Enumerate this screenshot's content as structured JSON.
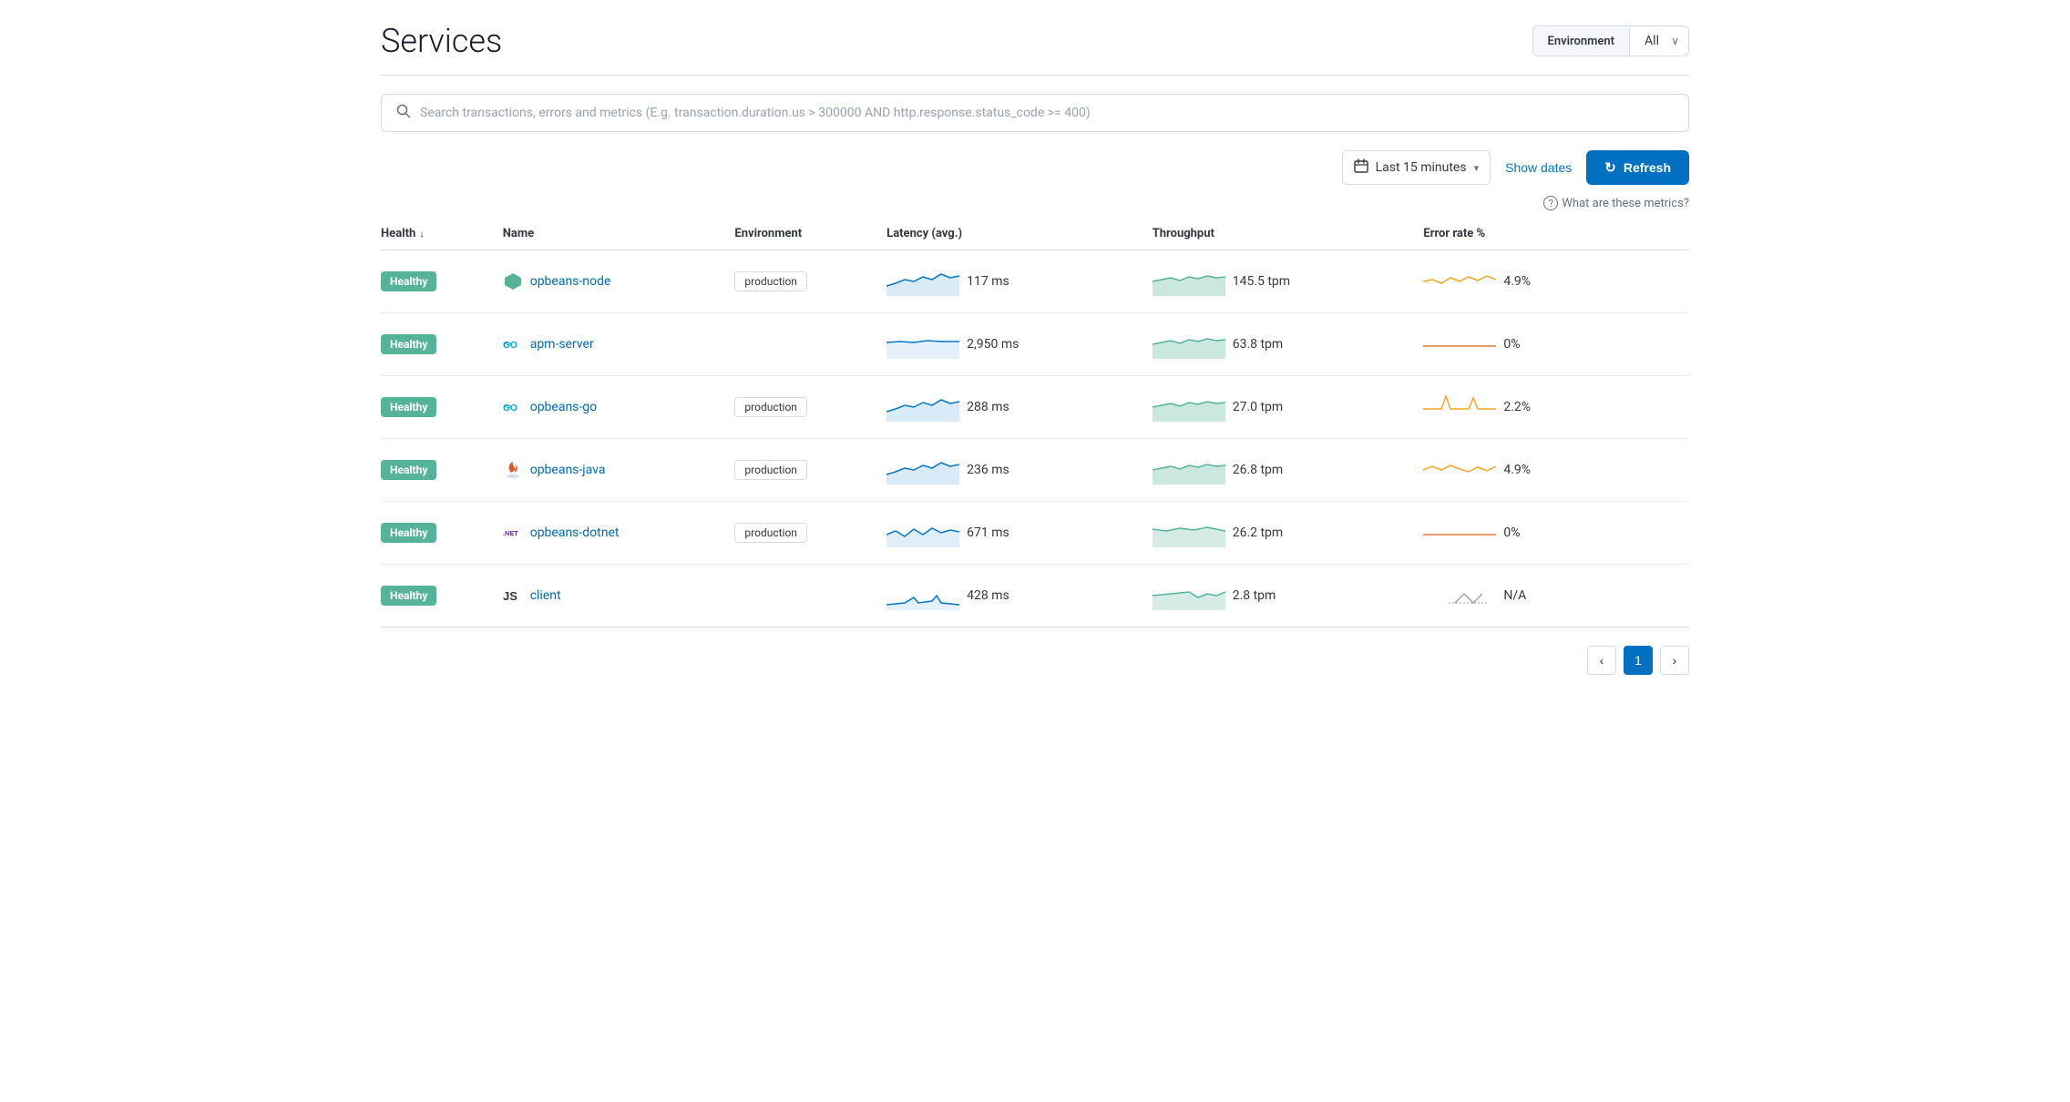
{
  "header": {
    "title": "Services",
    "env_label": "Environment",
    "env_value": "All"
  },
  "search": {
    "placeholder": "Search transactions, errors and metrics (E.g. transaction.duration.us > 300000 AND http.response.status_code >= 400)"
  },
  "toolbar": {
    "time_range": "Last 15 minutes",
    "show_dates_label": "Show dates",
    "refresh_label": "Refresh"
  },
  "metrics_help": "What are these metrics?",
  "table": {
    "columns": [
      "Health",
      "Name",
      "Environment",
      "Latency (avg.)",
      "Throughput",
      "Error rate %"
    ],
    "rows": [
      {
        "health": "Healthy",
        "icon_type": "node",
        "name": "opbeans-node",
        "environment": "production",
        "latency": "117 ms",
        "throughput": "145.5 tpm",
        "error_rate": "4.9%",
        "latency_sparkline": "blue",
        "throughput_sparkline": "green",
        "error_sparkline": "orange_wavy"
      },
      {
        "health": "Healthy",
        "icon_type": "go",
        "name": "apm-server",
        "environment": "",
        "latency": "2,950 ms",
        "throughput": "63.8 tpm",
        "error_rate": "0%",
        "latency_sparkline": "blue_flat",
        "throughput_sparkline": "green",
        "error_sparkline": "orange_flat"
      },
      {
        "health": "Healthy",
        "icon_type": "go",
        "name": "opbeans-go",
        "environment": "production",
        "latency": "288 ms",
        "throughput": "27.0 tpm",
        "error_rate": "2.2%",
        "latency_sparkline": "blue",
        "throughput_sparkline": "green",
        "error_sparkline": "orange_spike"
      },
      {
        "health": "Healthy",
        "icon_type": "java",
        "name": "opbeans-java",
        "environment": "production",
        "latency": "236 ms",
        "throughput": "26.8 tpm",
        "error_rate": "4.9%",
        "latency_sparkline": "blue",
        "throughput_sparkline": "green",
        "error_sparkline": "orange_wavy2"
      },
      {
        "health": "Healthy",
        "icon_type": "dotnet",
        "name": "opbeans-dotnet",
        "environment": "production",
        "latency": "671 ms",
        "throughput": "26.2 tpm",
        "error_rate": "0%",
        "latency_sparkline": "blue_wavy",
        "throughput_sparkline": "green_flat",
        "error_sparkline": "orange_flat"
      },
      {
        "health": "Healthy",
        "icon_type": "js",
        "name": "client",
        "environment": "",
        "latency": "428 ms",
        "throughput": "2.8 tpm",
        "error_rate": "N/A",
        "latency_sparkline": "blue_sparse",
        "throughput_sparkline": "green_sparse",
        "error_sparkline": "na"
      }
    ]
  },
  "pagination": {
    "prev_label": "‹",
    "next_label": "›",
    "current_page": "1"
  }
}
